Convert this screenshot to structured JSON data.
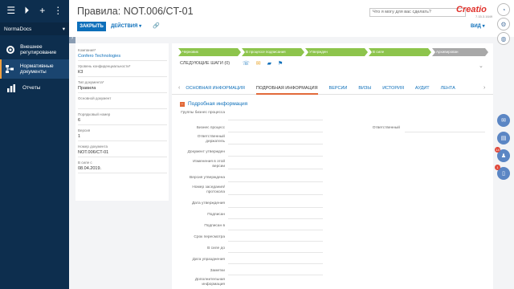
{
  "sidebar": {
    "workspace": "NormaDocs",
    "items": [
      {
        "label": "Внешнее регулирование",
        "icon": "gear-icon"
      },
      {
        "label": "Нормативные документы",
        "icon": "hierarchy-icon"
      },
      {
        "label": "Отчеты",
        "icon": "chart-icon"
      }
    ]
  },
  "header": {
    "title": "Правила: NOT.006/CT-01",
    "search_placeholder": "Что я могу для вас сделать?",
    "logo": "Creatio",
    "version": "7.15.3.1649",
    "close_label": "ЗАКРЫТЬ",
    "actions_label": "ДЕЙСТВИЯ ▾",
    "view_label": "ВИД ▾"
  },
  "fields": [
    {
      "label": "Компания*",
      "value": "Confero Technologies",
      "link": true
    },
    {
      "label": "Уровень конфиденциальности*",
      "value": "К3",
      "link": false
    },
    {
      "label": "Тип документа*",
      "value": "Правила",
      "link": false
    },
    {
      "label": "Основной документ",
      "value": "",
      "link": false
    },
    {
      "label": "Порядковый номер",
      "value": "6",
      "link": false
    },
    {
      "label": "Версия",
      "value": "1",
      "link": false
    },
    {
      "label": "Номер документа",
      "value": "NOT.006/CT-01",
      "link": false
    },
    {
      "label": "В силе с",
      "value": "08.04.2019.",
      "link": false
    }
  ],
  "stages": [
    {
      "label": "Черновик",
      "state": "done"
    },
    {
      "label": "В процессе подписания",
      "state": "done"
    },
    {
      "label": "Утвержден",
      "state": "done"
    },
    {
      "label": "В силе",
      "state": "done"
    },
    {
      "label": "Архивирован",
      "state": "todo"
    }
  ],
  "next_steps": "СЛЕДУЮЩИЕ ШАГИ (0)",
  "tabs": [
    {
      "label": "ОСНОВНАЯ ИНФОРМАЦИЯ",
      "active": false
    },
    {
      "label": "ПОДРОБНАЯ ИНФОРМАЦИЯ",
      "active": true
    },
    {
      "label": "ВЕРСИИ",
      "active": false
    },
    {
      "label": "ВИЗЫ",
      "active": false
    },
    {
      "label": "ИСТОРИЯ",
      "active": false
    },
    {
      "label": "АУДИТ",
      "active": false
    },
    {
      "label": "ЛЕНТА",
      "active": false
    }
  ],
  "section_title": "Подробная информация",
  "form_labels": [
    "Группы бизнес процесса",
    "Бизнес процесс",
    "Ответственный держатель",
    "Документ утвержден",
    "Изменения в этой версии",
    "Версия утверждена",
    "Номер заседания/ протокола",
    "Дата утверждения",
    "Подписан",
    "Подписан в",
    "Срок пересмотра",
    "В силе до",
    "Дата упразднения",
    "Заметки",
    "Дополнительная информация"
  ],
  "right_label": "Ответственный",
  "badges": {
    "messages": "14",
    "other": "1"
  }
}
